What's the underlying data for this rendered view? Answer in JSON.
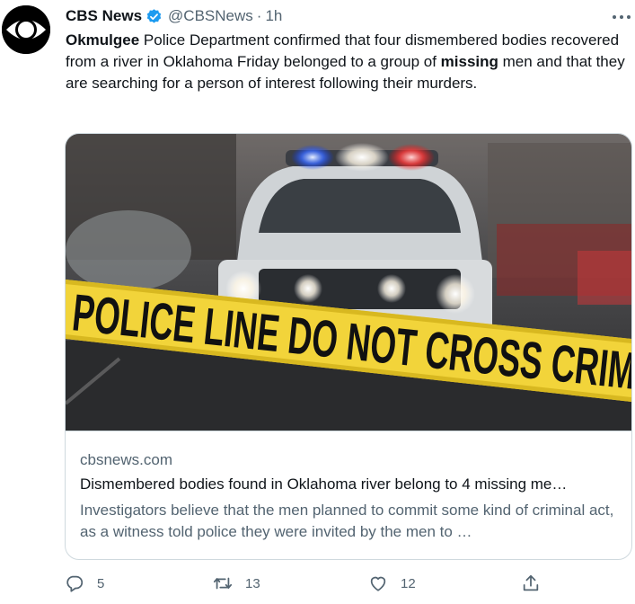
{
  "tweet": {
    "author_name": "CBS News",
    "handle": "@CBSNews",
    "separator": "·",
    "time": "1h",
    "text_parts": [
      {
        "text": "Okmulgee",
        "bold": true
      },
      {
        "text": " Police Department confirmed that four dismembered bodies recovered from a river in Oklahoma Friday belonged to a group of ",
        "bold": false
      },
      {
        "text": "missing",
        "bold": true
      },
      {
        "text": " men and that they are searching for a person of interest following their murders.",
        "bold": false
      }
    ]
  },
  "card": {
    "image_tape_text": "POLICE LINE DO NOT CROSS CRIM",
    "domain": "cbsnews.com",
    "title": "Dismembered bodies found in Oklahoma river belong to 4 missing me…",
    "description": "Investigators believe that the men planned to commit some kind of criminal act, as a witness told police they were invited by the men to …"
  },
  "actions": {
    "reply_count": "5",
    "retweet_count": "13",
    "like_count": "12"
  },
  "colors": {
    "text": "#0f1419",
    "secondary": "#536471",
    "verified": "#1d9bf0",
    "border": "#cfd9de",
    "tape": "#f2d43a"
  },
  "icons": [
    "cbs-eye-logo-icon",
    "verified-badge-icon",
    "more-options-icon",
    "reply-icon",
    "retweet-icon",
    "like-icon",
    "share-icon"
  ]
}
